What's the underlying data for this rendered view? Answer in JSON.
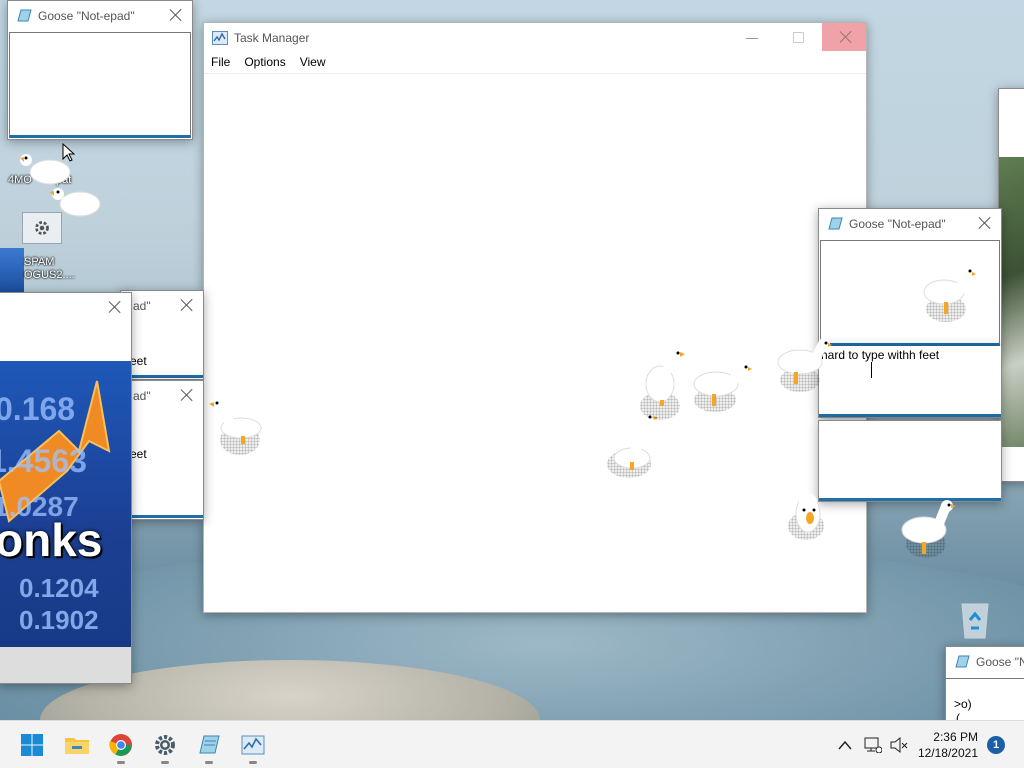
{
  "windows": {
    "notepad_title": "Goose \"Not-epad\"",
    "notepad_title_partial": "Goose \"N",
    "notepad_title_tail": "ad\"",
    "notepad_text_main": "hard to type withh feet",
    "notepad_text_left": "eet",
    "notepad_text_corner_line1": ">o)",
    "notepad_text_corner_line2": "( ."
  },
  "task_manager": {
    "title": "Task Manager",
    "menu": [
      "File",
      "Options",
      "View"
    ]
  },
  "meme": {
    "text": "onks",
    "numbers": [
      "0.168",
      "1.4563",
      "1.0287",
      "0.1204",
      "0.1902"
    ]
  },
  "desktop_icons": {
    "label_top": "4MO",
    "label_top2": "pat",
    "label_spam_1": "SPAM",
    "label_spam_2": "OGUS2...."
  },
  "taskbar": {
    "icons": [
      "windows-start",
      "file-explorer",
      "chrome",
      "settings",
      "notepad",
      "task-manager"
    ],
    "time": "2:36 PM",
    "date": "12/18/2021",
    "notification_count": "1"
  },
  "colors": {
    "accent_blue": "#1f6fa8",
    "close_red": "#e81123",
    "goose_beak": "#f5a623"
  }
}
